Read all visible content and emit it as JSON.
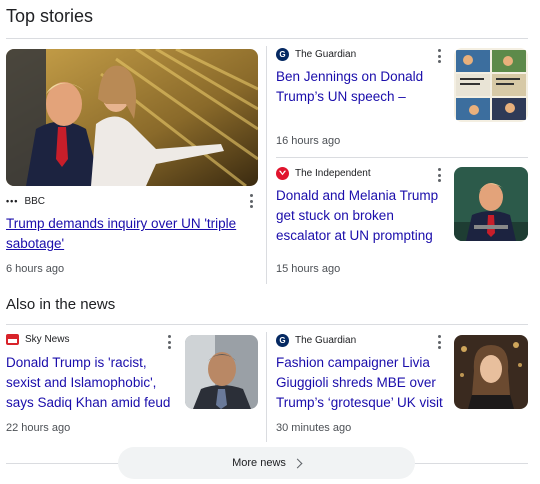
{
  "top_stories": {
    "title": "Top stories",
    "main": {
      "source": "BBC",
      "source_logo": "•••",
      "headline": "Trump demands inquiry over UN 'triple sabotage'",
      "time": "6 hours ago"
    },
    "side": [
      {
        "source": "The Guardian",
        "source_logo": "G",
        "headline": "Ben Jennings on Donald Trump’s UN speech – cartoon",
        "time": "16 hours ago"
      },
      {
        "source": "The Independent",
        "source_logo": "",
        "headline": "Donald and Melania Trump get stuck on broken escalator at UN prompting rant to…",
        "time": "15 hours ago"
      }
    ]
  },
  "also_in_news": {
    "title": "Also in the news",
    "items": [
      {
        "source": "Sky News",
        "headline": "Donald Trump is 'racist, sexist and Islamophobic', says Sadiq Khan amid feud with…",
        "time": "22 hours ago"
      },
      {
        "source": "The Guardian",
        "source_logo": "G",
        "headline": "Fashion campaigner Livia Giuggioli shreds MBE over Trump’s ‘grotesque’ UK visit",
        "time": "30 minutes ago"
      }
    ]
  },
  "more_news": {
    "label": "More news"
  },
  "colors": {
    "link": "#1a0dab",
    "divider": "#dadce0",
    "guardian": "#052962",
    "independent": "#e0142d",
    "sky": "#d8232a"
  }
}
